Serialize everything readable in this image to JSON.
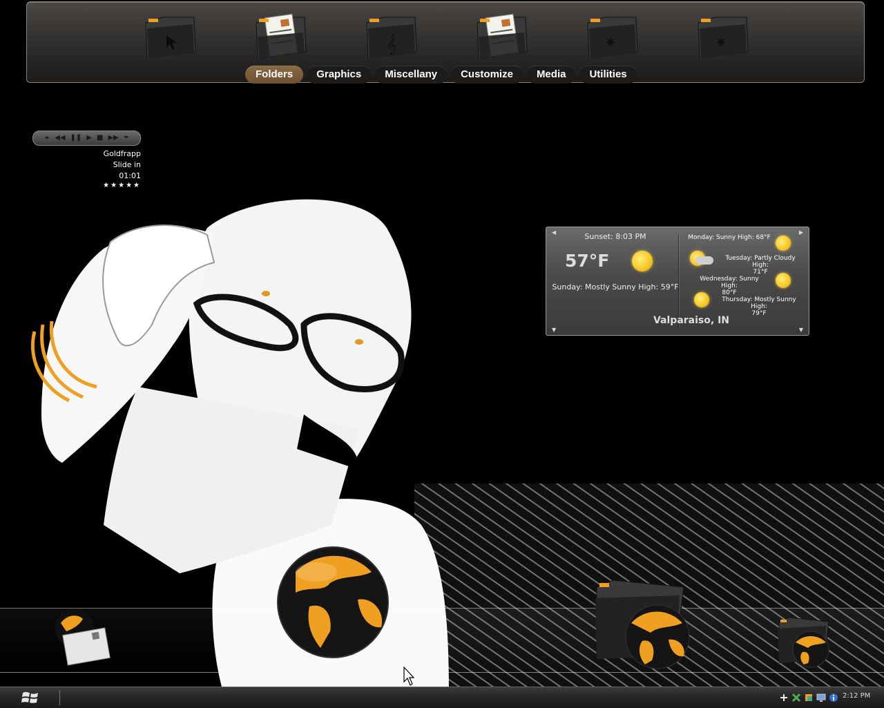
{
  "top_shelf": {
    "icons": [
      {
        "name": "folder-cursor-icon"
      },
      {
        "name": "folder-document-icon"
      },
      {
        "name": "folder-music-icon"
      },
      {
        "name": "folder-document-icon"
      },
      {
        "name": "folder-star-icon"
      },
      {
        "name": "folder-star-icon"
      }
    ],
    "tabs": [
      {
        "label": "Folders",
        "active": true
      },
      {
        "label": "Graphics",
        "active": false
      },
      {
        "label": "Miscellany",
        "active": false
      },
      {
        "label": "Customize",
        "active": false
      },
      {
        "label": "Media",
        "active": false
      },
      {
        "label": "Utilities",
        "active": false
      }
    ],
    "active_tab_color": "#7a5c3a"
  },
  "player": {
    "artist": "Goldfrapp",
    "track": "Slide in",
    "time": "01:01",
    "rating": "★★★★★",
    "buttons": [
      "prev",
      "rewind",
      "pause",
      "play",
      "stop",
      "forward",
      "next"
    ]
  },
  "weather": {
    "sunset": "Sunset: 8:03 PM",
    "temperature": "57°F",
    "today": "Sunday: Mostly Sunny High: 59°F",
    "location": "Valparaiso, IN",
    "forecast": [
      {
        "line1": "Monday: Sunny High: 68°F",
        "line2": ""
      },
      {
        "line1": "Tuesday: Partly Cloudy High:",
        "line2": "71°F"
      },
      {
        "line1": "Wednesday: Sunny High:",
        "line2": "80°F"
      },
      {
        "line1": "Thursday: Mostly Sunny High:",
        "line2": "79°F"
      }
    ]
  },
  "bottom_shelf": {
    "icons": [
      {
        "name": "mail-globe-icon"
      },
      {
        "name": "globe-icon"
      },
      {
        "name": "folder-globe-icon"
      },
      {
        "name": "folder-globe-small-icon"
      }
    ]
  },
  "taskbar": {
    "clock": "2:12 PM",
    "tray_icons": [
      "plus-icon",
      "network-icon",
      "app-icon",
      "monitor-icon",
      "info-icon"
    ]
  },
  "colors": {
    "accent": "#f0a020",
    "shelf_dark": "#2f2d2b"
  }
}
